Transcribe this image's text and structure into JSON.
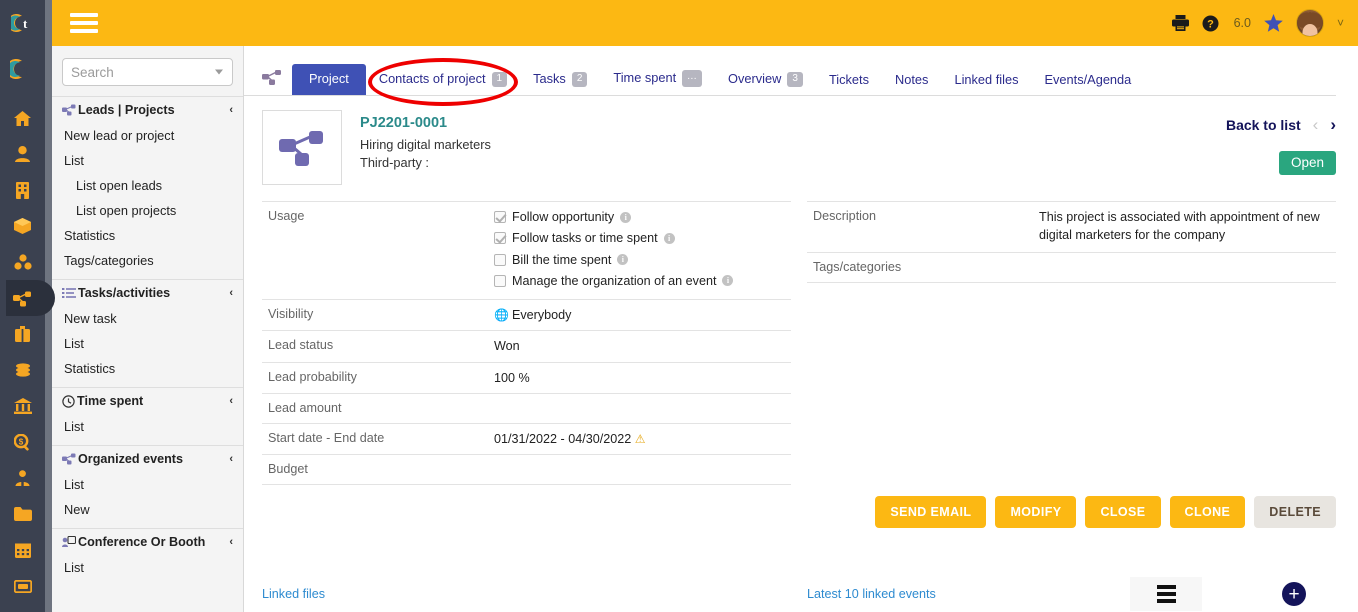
{
  "topbar": {
    "hamburger": "menu-icon",
    "print_icon": "printer-icon",
    "help_icon": "help-circle-icon",
    "version": "6.0",
    "star_icon": "star-icon",
    "avatar": "user-avatar",
    "caret": "˅"
  },
  "search": {
    "placeholder": "Search",
    "value": ""
  },
  "sidebar": {
    "groups": [
      {
        "label": "Leads | Projects",
        "icon": "project-node-icon",
        "chevron": "‹",
        "items": [
          {
            "label": "New lead or project",
            "sub": false
          },
          {
            "label": "List",
            "sub": false
          },
          {
            "label": "List open leads",
            "sub": true
          },
          {
            "label": "List open projects",
            "sub": true
          },
          {
            "label": "Statistics",
            "sub": false
          },
          {
            "label": "Tags/categories",
            "sub": false
          }
        ]
      },
      {
        "label": "Tasks/activities",
        "icon": "task-list-icon",
        "chevron": "‹",
        "items": [
          {
            "label": "New task",
            "sub": false
          },
          {
            "label": "List",
            "sub": false
          },
          {
            "label": "Statistics",
            "sub": false
          }
        ]
      },
      {
        "label": "Time spent",
        "icon": "clock-icon",
        "chevron": "‹",
        "items": [
          {
            "label": "List",
            "sub": false
          }
        ]
      },
      {
        "label": "Organized events",
        "icon": "project-node-icon",
        "chevron": "‹",
        "items": [
          {
            "label": "List",
            "sub": false
          },
          {
            "label": "New",
            "sub": false
          }
        ]
      },
      {
        "label": "Conference Or Booth",
        "icon": "conference-icon",
        "chevron": "‹",
        "items": [
          {
            "label": "List",
            "sub": false
          }
        ]
      }
    ]
  },
  "rail": {
    "icons": [
      "home-icon",
      "user-icon",
      "building-icon",
      "box-icon",
      "products-icon",
      "project-node-icon",
      "briefcase-icon",
      "coins-icon",
      "bank-icon",
      "money-search-icon",
      "employee-icon",
      "folder-icon",
      "calendar-icon",
      "ticket-icon"
    ]
  },
  "tabs": {
    "object_icon": "project-node-icon",
    "items": [
      {
        "label": "Project",
        "badge": "",
        "active": true
      },
      {
        "label": "Contacts of project",
        "badge": "1",
        "active": false,
        "annotated": true
      },
      {
        "label": "Tasks",
        "badge": "2",
        "active": false
      },
      {
        "label": "Time spent",
        "badge": "...",
        "active": false
      },
      {
        "label": "Overview",
        "badge": "3",
        "active": false
      },
      {
        "label": "Tickets",
        "badge": "",
        "active": false
      },
      {
        "label": "Notes",
        "badge": "",
        "active": false
      },
      {
        "label": "Linked files",
        "badge": "",
        "active": false
      },
      {
        "label": "Events/Agenda",
        "badge": "",
        "active": false
      }
    ]
  },
  "card": {
    "thumb_icon": "project-node-icon",
    "ref": "PJ2201-0001",
    "title": "Hiring digital marketers",
    "thirdparty": "Third-party :",
    "back_to_list": "Back to list",
    "prev_arrow": "‹",
    "next_arrow": "›",
    "status": "Open"
  },
  "left_fields": [
    {
      "label": "Usage",
      "type": "checkboxes",
      "checkboxes": [
        {
          "label": "Follow opportunity",
          "checked": true
        },
        {
          "label": "Follow tasks or time spent",
          "checked": true
        },
        {
          "label": "Bill the time spent",
          "checked": false
        },
        {
          "label": "Manage the organization of an event",
          "checked": false
        }
      ]
    },
    {
      "label": "Visibility",
      "type": "globe",
      "value": "Everybody"
    },
    {
      "label": "Lead status",
      "type": "text",
      "value": "Won"
    },
    {
      "label": "Lead probability",
      "type": "text",
      "value": "100 %"
    },
    {
      "label": "Lead amount",
      "type": "text",
      "value": ""
    },
    {
      "label": "Start date - End date",
      "type": "warn",
      "value": "01/31/2022 - 04/30/2022"
    },
    {
      "label": "Budget",
      "type": "text",
      "value": ""
    }
  ],
  "right_fields": [
    {
      "label": "Description",
      "value": "This project is associated with appointment of new digital marketers for the company"
    },
    {
      "label": "Tags/categories",
      "value": ""
    }
  ],
  "actions": [
    {
      "label": "SEND EMAIL",
      "style": "yellow"
    },
    {
      "label": "MODIFY",
      "style": "yellow"
    },
    {
      "label": "CLOSE",
      "style": "yellow"
    },
    {
      "label": "CLONE",
      "style": "yellow"
    },
    {
      "label": "DELETE",
      "style": "grey"
    }
  ],
  "bottom": {
    "linked_files": "Linked files",
    "latest_events": "Latest 10 linked events",
    "list_menu_icon": "list-menu-icon",
    "add_icon": "add-circle-icon",
    "add_glyph": "+"
  },
  "colors": {
    "brand_yellow": "#fcb813",
    "tab_active": "#3f51b5",
    "status_green": "#2aa67f",
    "annotation_red": "#ee0000",
    "rail_bg": "#3b4150",
    "link_blue": "#2e8bd0"
  }
}
